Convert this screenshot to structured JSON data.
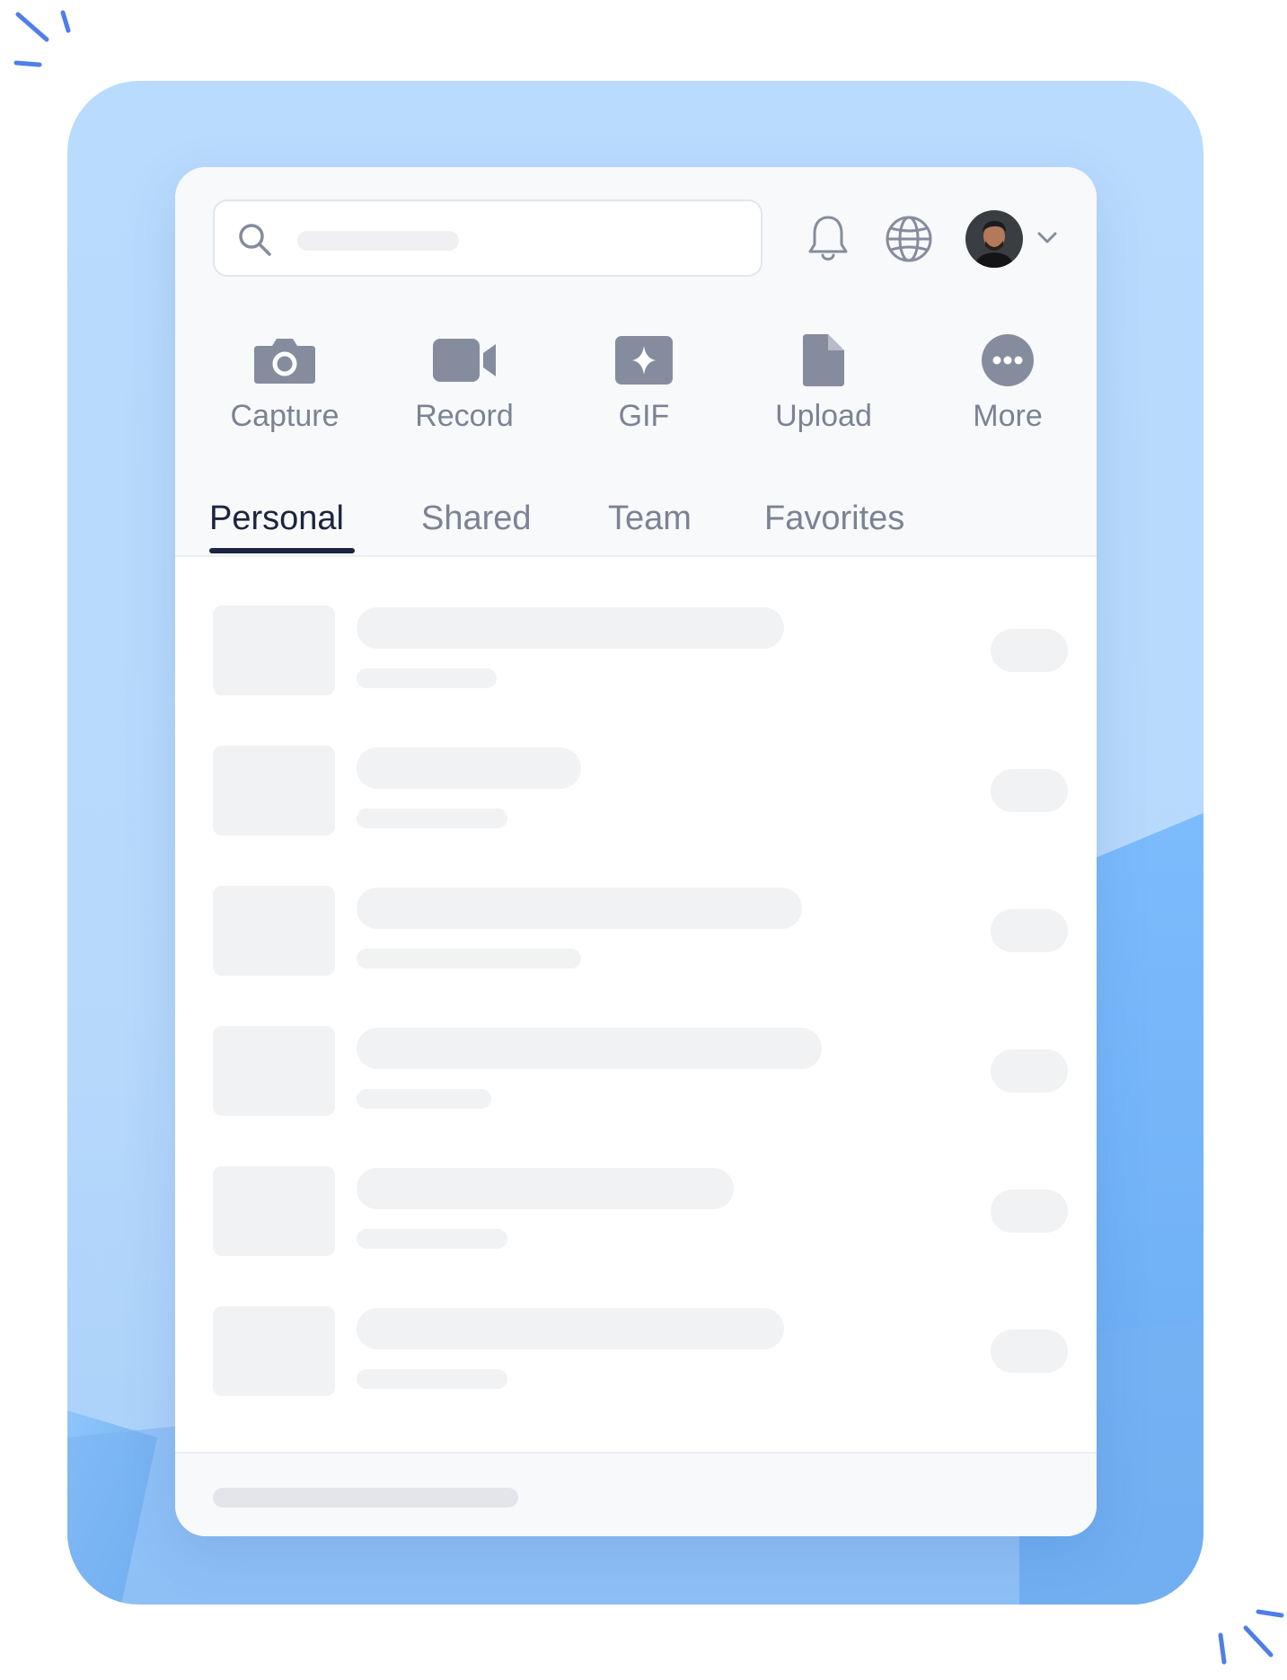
{
  "search": {
    "icon": "search-icon"
  },
  "header_icons": [
    "bell-icon",
    "globe-icon",
    "avatar",
    "chevron-down-icon"
  ],
  "actions": [
    {
      "label": "Capture",
      "icon": "camera-icon"
    },
    {
      "label": "Record",
      "icon": "video-icon"
    },
    {
      "label": "GIF",
      "icon": "sparkle-icon"
    },
    {
      "label": "Upload",
      "icon": "file-icon"
    },
    {
      "label": "More",
      "icon": "more-icon"
    }
  ],
  "tabs": [
    {
      "label": "Personal",
      "active": true
    },
    {
      "label": "Shared",
      "active": false
    },
    {
      "label": "Team",
      "active": false
    },
    {
      "label": "Favorites",
      "active": false
    }
  ],
  "colors": {
    "accent_dark": "#1b2440",
    "icon_gray": "#858c9d",
    "text_gray": "#7b8293",
    "backdrop_blue": "#b9dbfd",
    "spark_blue": "#4f7ee8"
  }
}
